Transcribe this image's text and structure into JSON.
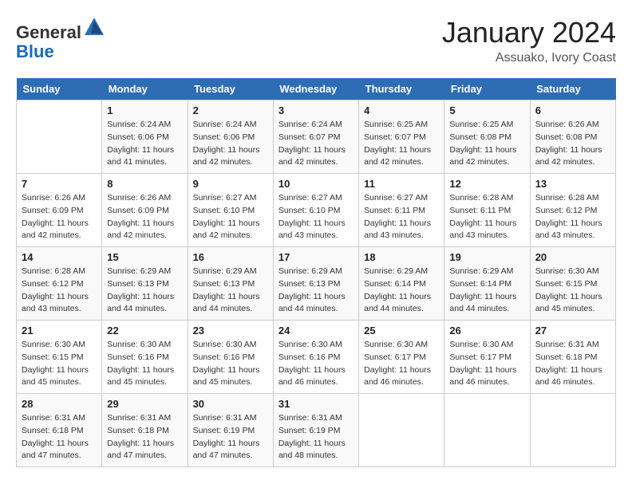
{
  "header": {
    "logo_line1": "General",
    "logo_line2": "Blue",
    "title": "January 2024",
    "subtitle": "Assuako, Ivory Coast"
  },
  "days_of_week": [
    "Sunday",
    "Monday",
    "Tuesday",
    "Wednesday",
    "Thursday",
    "Friday",
    "Saturday"
  ],
  "weeks": [
    [
      {
        "day": "",
        "sunrise": "",
        "sunset": "",
        "daylight": ""
      },
      {
        "day": "1",
        "sunrise": "Sunrise: 6:24 AM",
        "sunset": "Sunset: 6:06 PM",
        "daylight": "Daylight: 11 hours and 41 minutes."
      },
      {
        "day": "2",
        "sunrise": "Sunrise: 6:24 AM",
        "sunset": "Sunset: 6:06 PM",
        "daylight": "Daylight: 11 hours and 42 minutes."
      },
      {
        "day": "3",
        "sunrise": "Sunrise: 6:24 AM",
        "sunset": "Sunset: 6:07 PM",
        "daylight": "Daylight: 11 hours and 42 minutes."
      },
      {
        "day": "4",
        "sunrise": "Sunrise: 6:25 AM",
        "sunset": "Sunset: 6:07 PM",
        "daylight": "Daylight: 11 hours and 42 minutes."
      },
      {
        "day": "5",
        "sunrise": "Sunrise: 6:25 AM",
        "sunset": "Sunset: 6:08 PM",
        "daylight": "Daylight: 11 hours and 42 minutes."
      },
      {
        "day": "6",
        "sunrise": "Sunrise: 6:26 AM",
        "sunset": "Sunset: 6:08 PM",
        "daylight": "Daylight: 11 hours and 42 minutes."
      }
    ],
    [
      {
        "day": "7",
        "sunrise": "Sunrise: 6:26 AM",
        "sunset": "Sunset: 6:09 PM",
        "daylight": "Daylight: 11 hours and 42 minutes."
      },
      {
        "day": "8",
        "sunrise": "Sunrise: 6:26 AM",
        "sunset": "Sunset: 6:09 PM",
        "daylight": "Daylight: 11 hours and 42 minutes."
      },
      {
        "day": "9",
        "sunrise": "Sunrise: 6:27 AM",
        "sunset": "Sunset: 6:10 PM",
        "daylight": "Daylight: 11 hours and 42 minutes."
      },
      {
        "day": "10",
        "sunrise": "Sunrise: 6:27 AM",
        "sunset": "Sunset: 6:10 PM",
        "daylight": "Daylight: 11 hours and 43 minutes."
      },
      {
        "day": "11",
        "sunrise": "Sunrise: 6:27 AM",
        "sunset": "Sunset: 6:11 PM",
        "daylight": "Daylight: 11 hours and 43 minutes."
      },
      {
        "day": "12",
        "sunrise": "Sunrise: 6:28 AM",
        "sunset": "Sunset: 6:11 PM",
        "daylight": "Daylight: 11 hours and 43 minutes."
      },
      {
        "day": "13",
        "sunrise": "Sunrise: 6:28 AM",
        "sunset": "Sunset: 6:12 PM",
        "daylight": "Daylight: 11 hours and 43 minutes."
      }
    ],
    [
      {
        "day": "14",
        "sunrise": "Sunrise: 6:28 AM",
        "sunset": "Sunset: 6:12 PM",
        "daylight": "Daylight: 11 hours and 43 minutes."
      },
      {
        "day": "15",
        "sunrise": "Sunrise: 6:29 AM",
        "sunset": "Sunset: 6:13 PM",
        "daylight": "Daylight: 11 hours and 44 minutes."
      },
      {
        "day": "16",
        "sunrise": "Sunrise: 6:29 AM",
        "sunset": "Sunset: 6:13 PM",
        "daylight": "Daylight: 11 hours and 44 minutes."
      },
      {
        "day": "17",
        "sunrise": "Sunrise: 6:29 AM",
        "sunset": "Sunset: 6:13 PM",
        "daylight": "Daylight: 11 hours and 44 minutes."
      },
      {
        "day": "18",
        "sunrise": "Sunrise: 6:29 AM",
        "sunset": "Sunset: 6:14 PM",
        "daylight": "Daylight: 11 hours and 44 minutes."
      },
      {
        "day": "19",
        "sunrise": "Sunrise: 6:29 AM",
        "sunset": "Sunset: 6:14 PM",
        "daylight": "Daylight: 11 hours and 44 minutes."
      },
      {
        "day": "20",
        "sunrise": "Sunrise: 6:30 AM",
        "sunset": "Sunset: 6:15 PM",
        "daylight": "Daylight: 11 hours and 45 minutes."
      }
    ],
    [
      {
        "day": "21",
        "sunrise": "Sunrise: 6:30 AM",
        "sunset": "Sunset: 6:15 PM",
        "daylight": "Daylight: 11 hours and 45 minutes."
      },
      {
        "day": "22",
        "sunrise": "Sunrise: 6:30 AM",
        "sunset": "Sunset: 6:16 PM",
        "daylight": "Daylight: 11 hours and 45 minutes."
      },
      {
        "day": "23",
        "sunrise": "Sunrise: 6:30 AM",
        "sunset": "Sunset: 6:16 PM",
        "daylight": "Daylight: 11 hours and 45 minutes."
      },
      {
        "day": "24",
        "sunrise": "Sunrise: 6:30 AM",
        "sunset": "Sunset: 6:16 PM",
        "daylight": "Daylight: 11 hours and 46 minutes."
      },
      {
        "day": "25",
        "sunrise": "Sunrise: 6:30 AM",
        "sunset": "Sunset: 6:17 PM",
        "daylight": "Daylight: 11 hours and 46 minutes."
      },
      {
        "day": "26",
        "sunrise": "Sunrise: 6:30 AM",
        "sunset": "Sunset: 6:17 PM",
        "daylight": "Daylight: 11 hours and 46 minutes."
      },
      {
        "day": "27",
        "sunrise": "Sunrise: 6:31 AM",
        "sunset": "Sunset: 6:18 PM",
        "daylight": "Daylight: 11 hours and 46 minutes."
      }
    ],
    [
      {
        "day": "28",
        "sunrise": "Sunrise: 6:31 AM",
        "sunset": "Sunset: 6:18 PM",
        "daylight": "Daylight: 11 hours and 47 minutes."
      },
      {
        "day": "29",
        "sunrise": "Sunrise: 6:31 AM",
        "sunset": "Sunset: 6:18 PM",
        "daylight": "Daylight: 11 hours and 47 minutes."
      },
      {
        "day": "30",
        "sunrise": "Sunrise: 6:31 AM",
        "sunset": "Sunset: 6:19 PM",
        "daylight": "Daylight: 11 hours and 47 minutes."
      },
      {
        "day": "31",
        "sunrise": "Sunrise: 6:31 AM",
        "sunset": "Sunset: 6:19 PM",
        "daylight": "Daylight: 11 hours and 48 minutes."
      },
      {
        "day": "",
        "sunrise": "",
        "sunset": "",
        "daylight": ""
      },
      {
        "day": "",
        "sunrise": "",
        "sunset": "",
        "daylight": ""
      },
      {
        "day": "",
        "sunrise": "",
        "sunset": "",
        "daylight": ""
      }
    ]
  ]
}
